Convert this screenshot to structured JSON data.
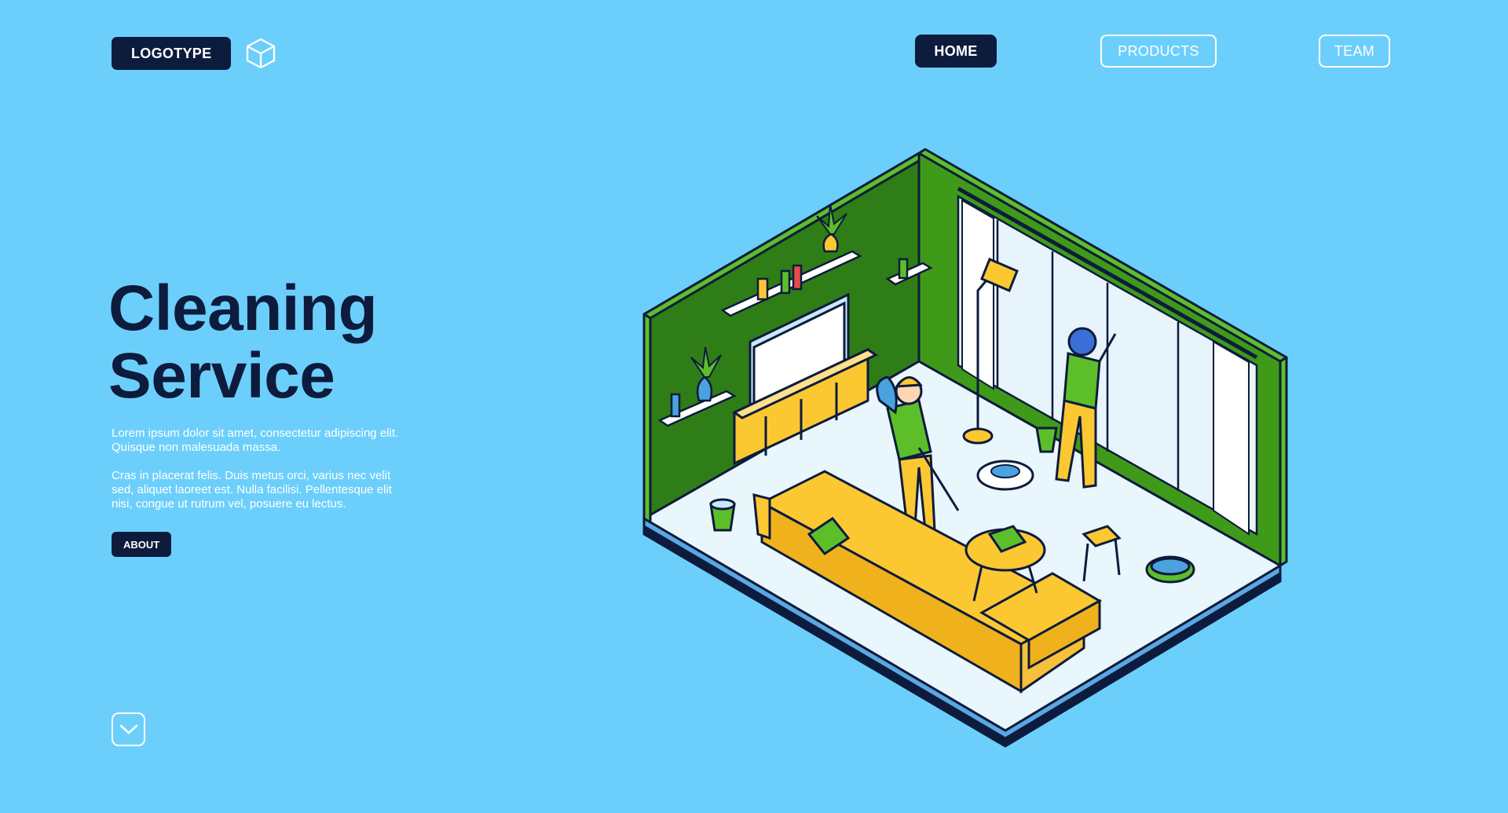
{
  "header": {
    "logo_label": "LOGOTYPE",
    "logo_icon": "cube-icon"
  },
  "nav": {
    "home": "HOME",
    "products": "PRODUCTS",
    "team": "TEAM"
  },
  "hero": {
    "title_line1": "Cleaning",
    "title_line2": "Service",
    "paragraph1": "Lorem ipsum dolor sit amet, consectetur adipiscing elit. Quisque non malesuada massa.",
    "paragraph2": "Cras in placerat felis. Duis metus orci, varius nec velit sed, aliquet laoreet est. Nulla facilisi. Pellentesque elit nisi, congue ut rutrum vel, posuere eu lectus.",
    "about_label": "ABOUT"
  },
  "scroll": {
    "icon": "chevron-down-icon"
  },
  "colors": {
    "background": "#6ccffb",
    "navy": "#0d1b3d",
    "wall_green": "#2f7d16",
    "accent_green": "#5cbf2a",
    "sofa_yellow": "#fbc832"
  }
}
